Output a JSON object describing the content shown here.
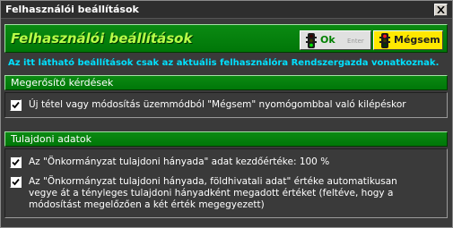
{
  "window": {
    "title": "Felhasználói beállítások",
    "close_symbol": "×"
  },
  "header": {
    "title": "Felhasználói beállítások",
    "ok_label": "Ok",
    "ok_hint": "Enter",
    "cancel_label": "Mégsem",
    "icons": [
      "traffic-light-green-icon",
      "traffic-light-red-icon"
    ]
  },
  "info_text": "Az itt látható beállítások csak az aktuális felhasználóra Rendszergazda vonatkoznak.",
  "sections": [
    {
      "title": "Megerősítő kérdések",
      "items": [
        {
          "label": "Új tétel vagy módosítás üzemmódból \"Mégsem\" nyomógombbal való kilépéskor",
          "checked": true
        }
      ]
    },
    {
      "title": "Tulajdoni adatok",
      "items": [
        {
          "label": "Az \"Önkormányzat tulajdoni hányada\" adat kezdőértéke: 100 %",
          "checked": true
        },
        {
          "label": "Az \"Önkormányzat tulajdoni hányada, földhivatali adat\" értéke automatikusan vegye át a tényleges tulajdoni hányadként megadott értéket (feltéve, hogy a módosítást megelőzően a két érték megegyezett)",
          "checked": true
        }
      ]
    }
  ],
  "colors": {
    "accent_green": "#007708",
    "title_green": "#b8ff48",
    "info_cyan": "#00e0ff",
    "cancel_yellow": "#ffe800"
  }
}
